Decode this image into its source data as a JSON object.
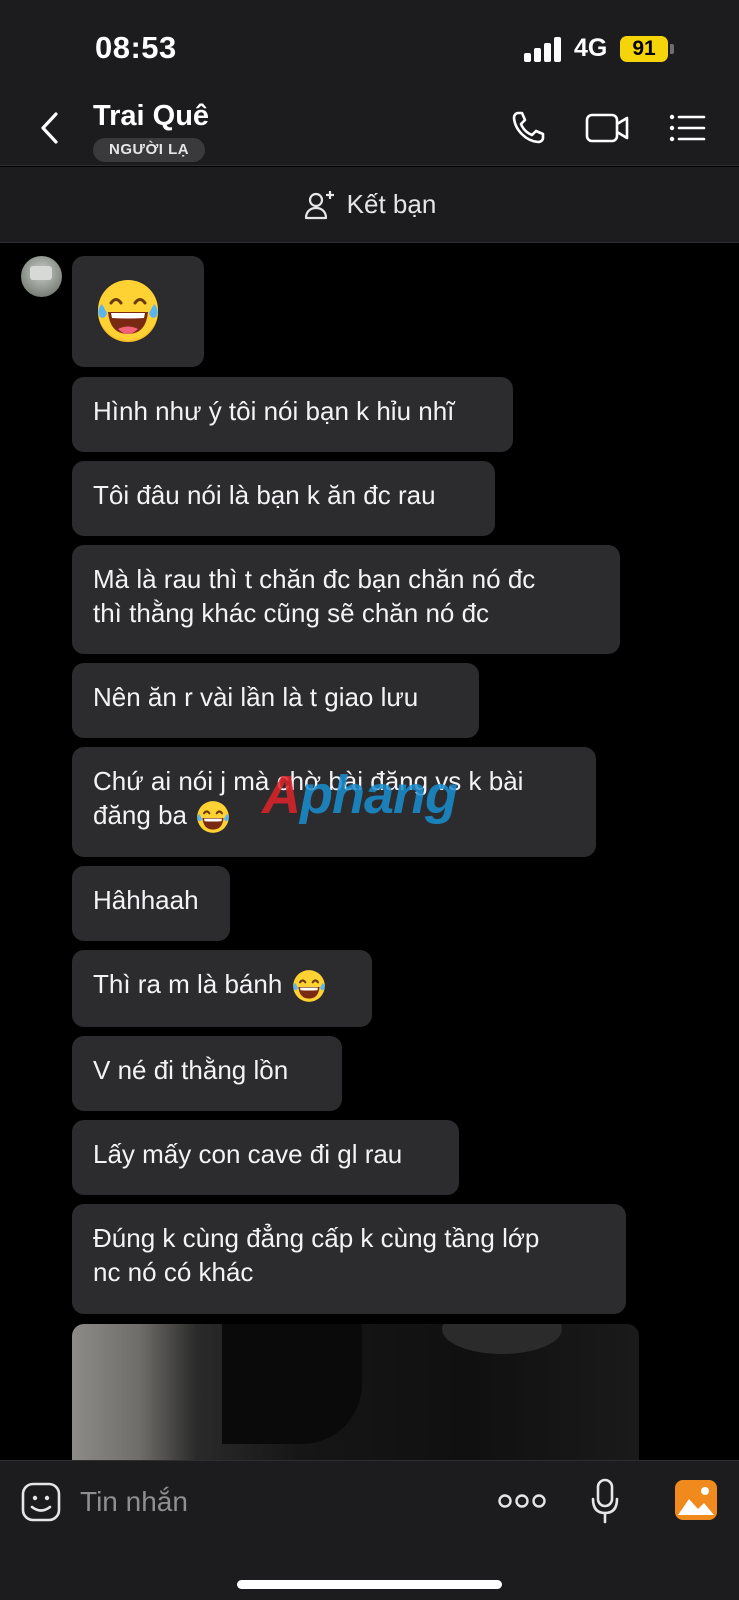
{
  "status_bar": {
    "time": "08:53",
    "network": "4G",
    "battery": "91"
  },
  "header": {
    "contact_name": "Trai Quê",
    "badge": "NGƯỜI LẠ"
  },
  "friend_bar": {
    "label": "Kết bạn"
  },
  "watermark": {
    "part1": "A",
    "part2": "phang"
  },
  "messages": [
    {
      "text": ""
    },
    {
      "text": "Hình như ý tôi nói bạn k hỉu nhĩ"
    },
    {
      "text": "Tôi đâu nói là bạn k ăn đc rau"
    },
    {
      "line1": "Mà là rau thì t chăn đc bạn chăn nó đc",
      "line2": "thì thằng khác cũng sẽ chăn nó đc"
    },
    {
      "text": "Nên ăn r vài lần là t giao lưu"
    },
    {
      "line1": "Chứ ai nói j mà chờ bài đăng vs k bài",
      "line2": "đăng ba"
    },
    {
      "text": "Hâhhaah"
    },
    {
      "text": "Thì ra m là bánh"
    },
    {
      "text": "V  né đi thằng lồn"
    },
    {
      "text": "Lấy mấy con cave đi gl rau"
    },
    {
      "line1": "Đúng k cùng đẳng cấp k cùng tầng lớp",
      "line2": "nc nó có khác"
    }
  ],
  "input": {
    "placeholder": "Tin nhắn"
  },
  "colors": {
    "bubble": "#2c2c2e",
    "bar": "#1c1c1e",
    "battery": "#f5d50a",
    "gallery_icon": "#f08a1c"
  }
}
